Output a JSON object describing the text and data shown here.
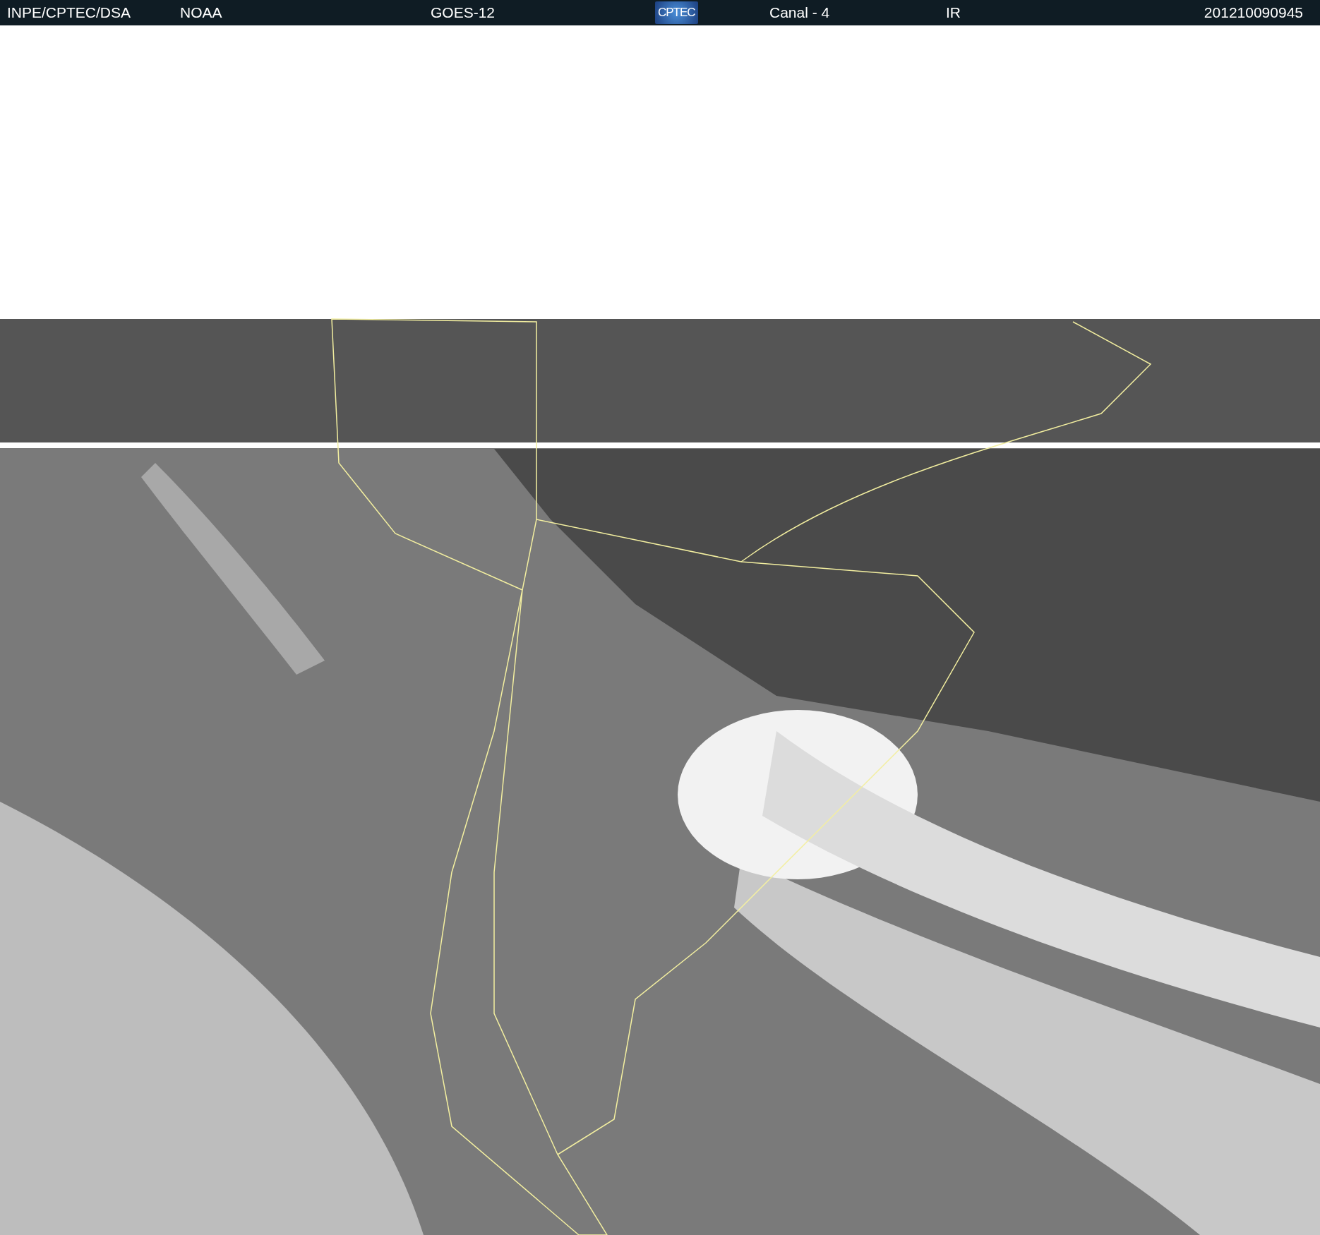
{
  "header": {
    "items": [
      {
        "kind": "text",
        "text": "INPE/CPTEC/DSA"
      },
      {
        "kind": "text",
        "text": "NOAA"
      },
      {
        "kind": "text",
        "text": "GOES-12"
      },
      {
        "kind": "logo",
        "text": "CPTEC"
      },
      {
        "kind": "text",
        "text": "Canal - 4"
      },
      {
        "kind": "text",
        "text": "IR"
      },
      {
        "kind": "text",
        "text": "201210090945"
      }
    ]
  }
}
